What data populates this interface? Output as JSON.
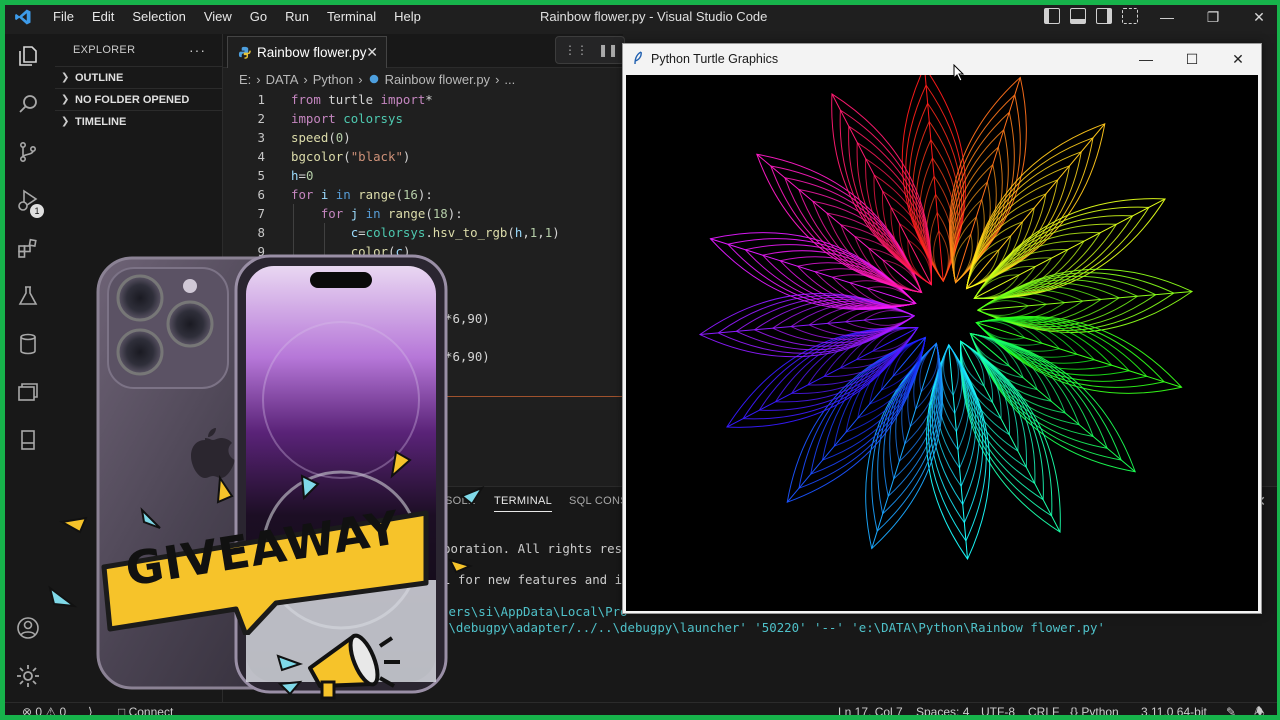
{
  "titlebar": {
    "menu": [
      "File",
      "Edit",
      "Selection",
      "View",
      "Go",
      "Run",
      "Terminal",
      "Help"
    ],
    "window_title": "Rainbow flower.py - Visual Studio Code"
  },
  "explorer": {
    "header": "EXPLORER",
    "more": "···",
    "sections": [
      "OUTLINE",
      "NO FOLDER OPENED",
      "TIMELINE"
    ]
  },
  "activity": {
    "badge": "1"
  },
  "editor": {
    "tab_label": "Rainbow flower.py",
    "breadcrumb": [
      "E:",
      "DATA",
      "Python",
      "Rainbow flower.py",
      "..."
    ],
    "lines": [
      {
        "n": "1",
        "html": "<span class='kw'>from</span> turtle <span class='kw'>import</span>*"
      },
      {
        "n": "2",
        "html": "<span class='kw'>import</span> <span class='md'>colorsys</span>"
      },
      {
        "n": "3",
        "html": "<span class='fn'>speed</span>(<span class='num'>0</span>)"
      },
      {
        "n": "4",
        "html": "<span class='fn'>bgcolor</span>(<span class='str'>\"black\"</span>)"
      },
      {
        "n": "5",
        "html": "<span class='var'>h</span>=<span class='num'>0</span>"
      },
      {
        "n": "6",
        "html": "<span class='kw'>for</span> <span class='var'>i</span> <span class='kw2'>in</span> <span class='fn'>range</span>(<span class='num'>16</span>):"
      },
      {
        "n": "7",
        "html": "    <span class='kw'>for</span> <span class='var'>j</span> <span class='kw2'>in</span> <span class='fn'>range</span>(<span class='num'>18</span>):"
      },
      {
        "n": "8",
        "html": "        <span class='var'>c</span>=<span class='md'>colorsys</span>.<span class='fn'>hsv_to_rgb</span>(<span class='var'>h</span>,<span class='num'>1</span>,<span class='num'>1</span>)"
      },
      {
        "n": "9",
        "html": "        <span class='fn'>color</span>(<span class='var'>c</span>)"
      }
    ],
    "partial_lines": [
      "*6,90)",
      "*6,90)"
    ]
  },
  "panel": {
    "tabs": [
      "SOLE",
      "TERMINAL",
      "SQL CONSO"
    ],
    "lines": [
      "poration. All rights rese",
      "l for new features and i",
      "sers\\si\\AppData\\Local\\Pro",
      "n\\debugpy\\adapter/../..\\debugpy\\launcher' '50220' '--' 'e:\\DATA\\Python\\Rainbow flower.py'"
    ]
  },
  "status": {
    "errors": "0",
    "warnings": "0",
    "connect": "Connect",
    "position": "Ln 17, Col 7",
    "spaces": "Spaces: 4",
    "encoding": "UTF-8",
    "eol": "CRLF",
    "language": "Python",
    "interpreter": "3.11.0 64-bit"
  },
  "turtle_window": {
    "title": "Python Turtle Graphics"
  },
  "overlay": {
    "giveaway_text": "GIVEAWAY"
  }
}
